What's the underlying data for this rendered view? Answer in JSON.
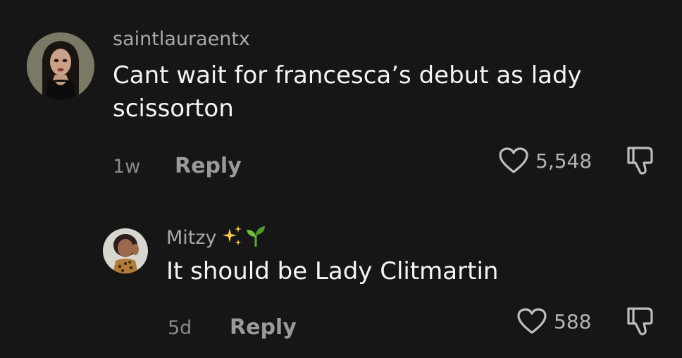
{
  "comments": [
    {
      "username": "saintlauraentx",
      "text": "Cant wait for francesca’s debut as lady scissorton",
      "time": "1w",
      "reply_label": "Reply",
      "likes": "5,548",
      "avatar": "bratz-doll-avatar-icon"
    }
  ],
  "replies": [
    {
      "username": "Mitzy",
      "username_emoji": [
        "sparkles-icon",
        "seedling-icon"
      ],
      "text": "It should be Lady Clitmartin",
      "time": "5d",
      "reply_label": "Reply",
      "likes": "588",
      "avatar": "person-photo-avatar-icon"
    }
  ],
  "icons": {
    "like": "heart-outline-icon",
    "dislike": "thumbs-down-outline-icon"
  },
  "colors": {
    "background": "#161616",
    "username": "#a8a8a8",
    "text": "#f4f4f4",
    "meta": "#8a8a8a"
  }
}
